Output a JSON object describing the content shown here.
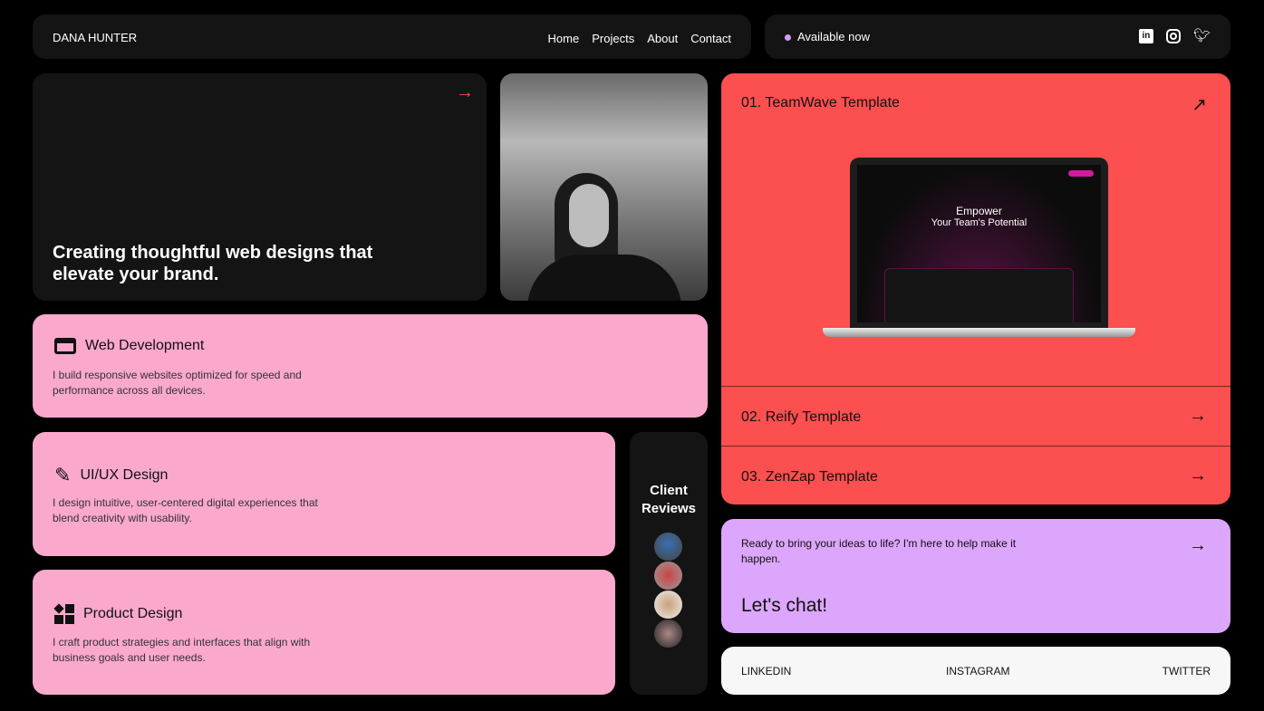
{
  "header": {
    "brand": "DANA HUNTER",
    "nav": [
      "Home",
      "Projects",
      "About",
      "Contact"
    ],
    "status": "Available now",
    "status_color": "#d79bf7",
    "socials": [
      "linkedin-icon",
      "instagram-icon",
      "twitter-icon"
    ]
  },
  "hero": {
    "headline": "Creating thoughtful web designs that elevate your brand."
  },
  "services": [
    {
      "title": "Web Development",
      "desc": "I build responsive websites optimized for speed and performance across all devices.",
      "icon": "layout-icon"
    },
    {
      "title": "UI/UX Design",
      "desc": "I design intuitive, user-centered digital experiences that blend creativity with usability.",
      "icon": "pen-ruler-icon"
    },
    {
      "title": "Product Design",
      "desc": "I craft product strategies and interfaces that align with business goals and user needs.",
      "icon": "shapes-icon"
    }
  ],
  "reviews": {
    "title": "Client Reviews"
  },
  "projects": [
    {
      "label": "01.  TeamWave Template",
      "mock_headline": "Empower",
      "mock_sub": "Your Team's Potential"
    },
    {
      "label": "02.  Reify Template"
    },
    {
      "label": "03.  ZenZap Template"
    }
  ],
  "cta": {
    "text": "Ready to bring your ideas to life? I'm here to help make it happen.",
    "title": "Let's chat!"
  },
  "social_links": [
    "LINKEDIN",
    "INSTAGRAM",
    "TWITTER"
  ],
  "colors": {
    "pink": "#fba8cd",
    "red": "#fc4f4f",
    "lavender": "#dca6fc",
    "card": "#141414"
  }
}
